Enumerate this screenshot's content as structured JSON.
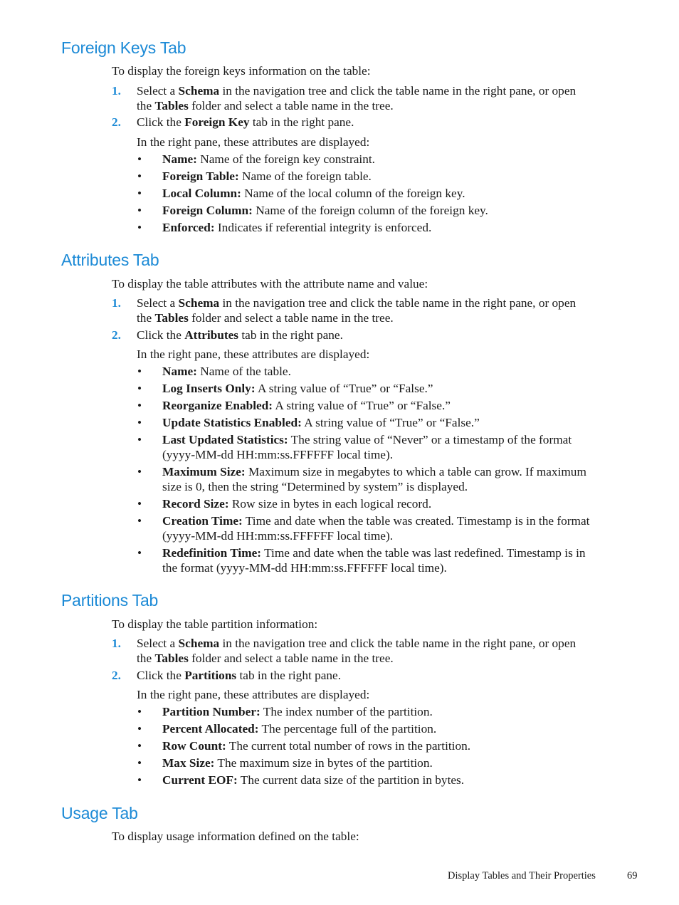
{
  "sections": [
    {
      "title": "Foreign Keys Tab",
      "intro": "To display the foreign keys information on the table:",
      "steps": [
        {
          "num": "1.",
          "parts": [
            "Select a ",
            "Schema",
            " in the navigation tree and click the table name in the right pane, or open",
            "the ",
            "Tables",
            " folder and select a table name in the tree."
          ]
        },
        {
          "num": "2.",
          "parts": [
            "Click the ",
            "Foreign Key",
            " tab in the right pane."
          ]
        }
      ],
      "attrs_intro": "In the right pane, these attributes are displayed:",
      "bullets": [
        {
          "term": "Name:",
          "desc": " Name of the foreign key constraint."
        },
        {
          "term": "Foreign Table:",
          "desc": " Name of the foreign table."
        },
        {
          "term": "Local Column:",
          "desc": " Name of the local column of the foreign key."
        },
        {
          "term": "Foreign Column:",
          "desc": " Name of the foreign column of the foreign key."
        },
        {
          "term": "Enforced:",
          "desc": " Indicates if referential integrity is enforced."
        }
      ]
    },
    {
      "title": "Attributes Tab",
      "intro": "To display the table attributes with the attribute name and value:",
      "steps": [
        {
          "num": "1.",
          "parts": [
            "Select a ",
            "Schema",
            " in the navigation tree and click the table name in the right pane, or open",
            "the ",
            "Tables",
            " folder and select a table name in the tree."
          ]
        },
        {
          "num": "2.",
          "parts": [
            "Click the ",
            "Attributes",
            " tab in the right pane."
          ]
        }
      ],
      "attrs_intro": "In the right pane, these attributes are displayed:",
      "bullets": [
        {
          "term": "Name:",
          "desc": " Name of the table."
        },
        {
          "term": "Log Inserts Only:",
          "desc": " A string value of “True” or “False.”"
        },
        {
          "term": "Reorganize Enabled:",
          "desc": " A string value of “True” or “False.”"
        },
        {
          "term": "Update Statistics Enabled:",
          "desc": " A string value of “True” or “False.”"
        },
        {
          "term": "Last Updated Statistics:",
          "desc": " The string value of “Never” or a timestamp of the format",
          "desc2": "(yyyy-MM-dd HH:mm:ss.FFFFFF local time)."
        },
        {
          "term": "Maximum Size:",
          "desc": " Maximum size in megabytes to which a table can grow. If maximum",
          "desc2": "size is 0, then the string “Determined by system” is displayed."
        },
        {
          "term": "Record Size:",
          "desc": " Row size in bytes in each logical record."
        },
        {
          "term": "Creation Time:",
          "desc": " Time and date when the table was created. Timestamp is in the format",
          "desc2": "(yyyy-MM-dd HH:mm:ss.FFFFFF local time)."
        },
        {
          "term": "Redefinition Time:",
          "desc": " Time and date when the table was last redefined. Timestamp is in",
          "desc2": "the format (yyyy-MM-dd HH:mm:ss.FFFFFF local time)."
        }
      ]
    },
    {
      "title": "Partitions Tab",
      "intro": "To display the table partition information:",
      "steps": [
        {
          "num": "1.",
          "parts": [
            "Select a ",
            "Schema",
            " in the navigation tree and click the table name in the right pane, or open",
            "the ",
            "Tables",
            " folder and select a table name in the tree."
          ]
        },
        {
          "num": "2.",
          "parts": [
            "Click the ",
            "Partitions",
            " tab in the right pane."
          ]
        }
      ],
      "attrs_intro": "In the right pane, these attributes are displayed:",
      "bullets": [
        {
          "term": "Partition Number:",
          "desc": " The index number of the partition."
        },
        {
          "term": "Percent Allocated:",
          "desc": " The percentage full of the partition."
        },
        {
          "term": "Row Count:",
          "desc": " The current total number of rows in the partition."
        },
        {
          "term": "Max Size:",
          "desc": " The maximum size in bytes of the partition."
        },
        {
          "term": "Current EOF:",
          "desc": " The current data size of the partition in bytes."
        }
      ]
    },
    {
      "title": "Usage Tab",
      "intro": "To display usage information defined on the table:"
    }
  ],
  "footer": {
    "chapter": "Display Tables and Their Properties",
    "page_number": "69"
  },
  "bullet_glyph": "•"
}
